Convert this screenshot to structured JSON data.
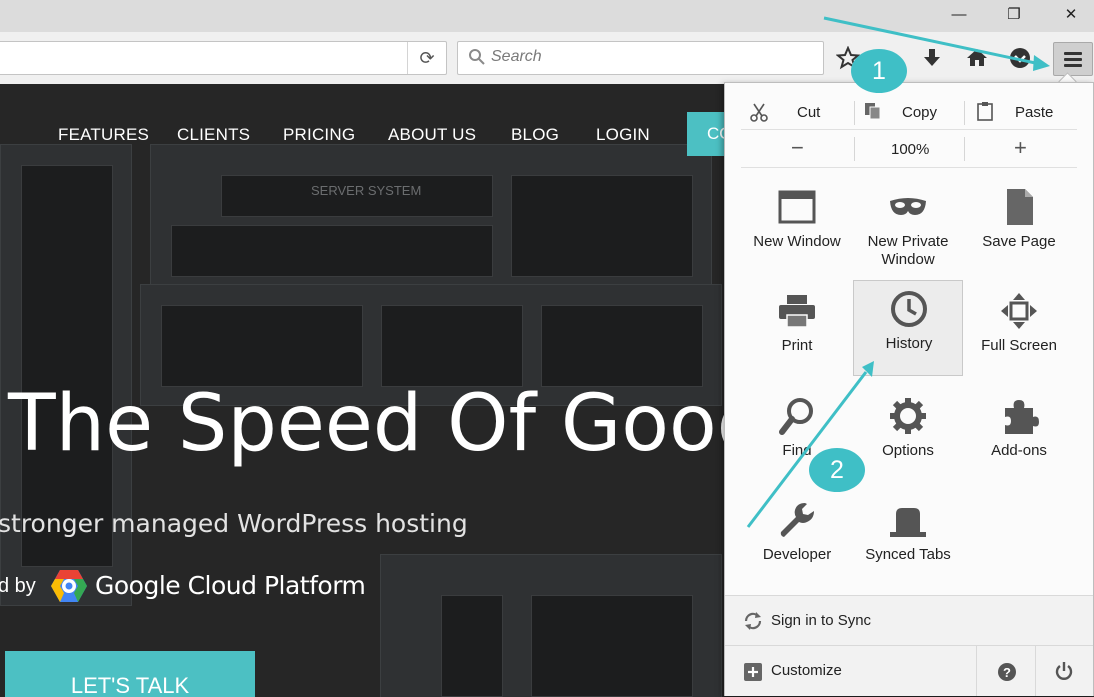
{
  "window": {
    "minimize": "—",
    "maximize": "❐",
    "close": "✕"
  },
  "toolbar": {
    "search_placeholder": "Search"
  },
  "site": {
    "nav": [
      "FEATURES",
      "CLIENTS",
      "PRICING",
      "ABOUT US",
      "BLOG",
      "LOGIN"
    ],
    "cta_partial": "CO",
    "server_label": "SERVER SYSTEM",
    "hero_title": "The Speed Of Goog",
    "hero_sub": "stronger managed WordPress hosting",
    "powered_by": "d by",
    "gcp": "Google Cloud Platform",
    "talk_button": "LET'S TALK"
  },
  "menu": {
    "edit": {
      "cut": "Cut",
      "copy": "Copy",
      "paste": "Paste"
    },
    "zoom": {
      "minus": "−",
      "level": "100%",
      "plus": "+"
    },
    "items": [
      {
        "label": "New Window",
        "icon": "new-window-icon"
      },
      {
        "label": "New Private\nWindow",
        "icon": "private-mask-icon"
      },
      {
        "label": "Save Page",
        "icon": "save-page-icon"
      },
      {
        "label": "Print",
        "icon": "printer-icon"
      },
      {
        "label": "History",
        "icon": "history-clock-icon"
      },
      {
        "label": "Full Screen",
        "icon": "fullscreen-icon"
      },
      {
        "label": "Find",
        "icon": "magnifier-icon"
      },
      {
        "label": "Options",
        "icon": "gear-icon"
      },
      {
        "label": "Add-ons",
        "icon": "puzzle-icon"
      },
      {
        "label": "Developer",
        "icon": "wrench-icon"
      },
      {
        "label": "Synced Tabs",
        "icon": "synced-tabs-icon"
      }
    ],
    "sync": "Sign in to Sync",
    "customize": "Customize"
  },
  "callouts": {
    "one": "1",
    "two": "2"
  },
  "colors": {
    "accent": "#4cc0c3",
    "callout": "#3fbfc6",
    "arrow": "#3fbfc6"
  }
}
